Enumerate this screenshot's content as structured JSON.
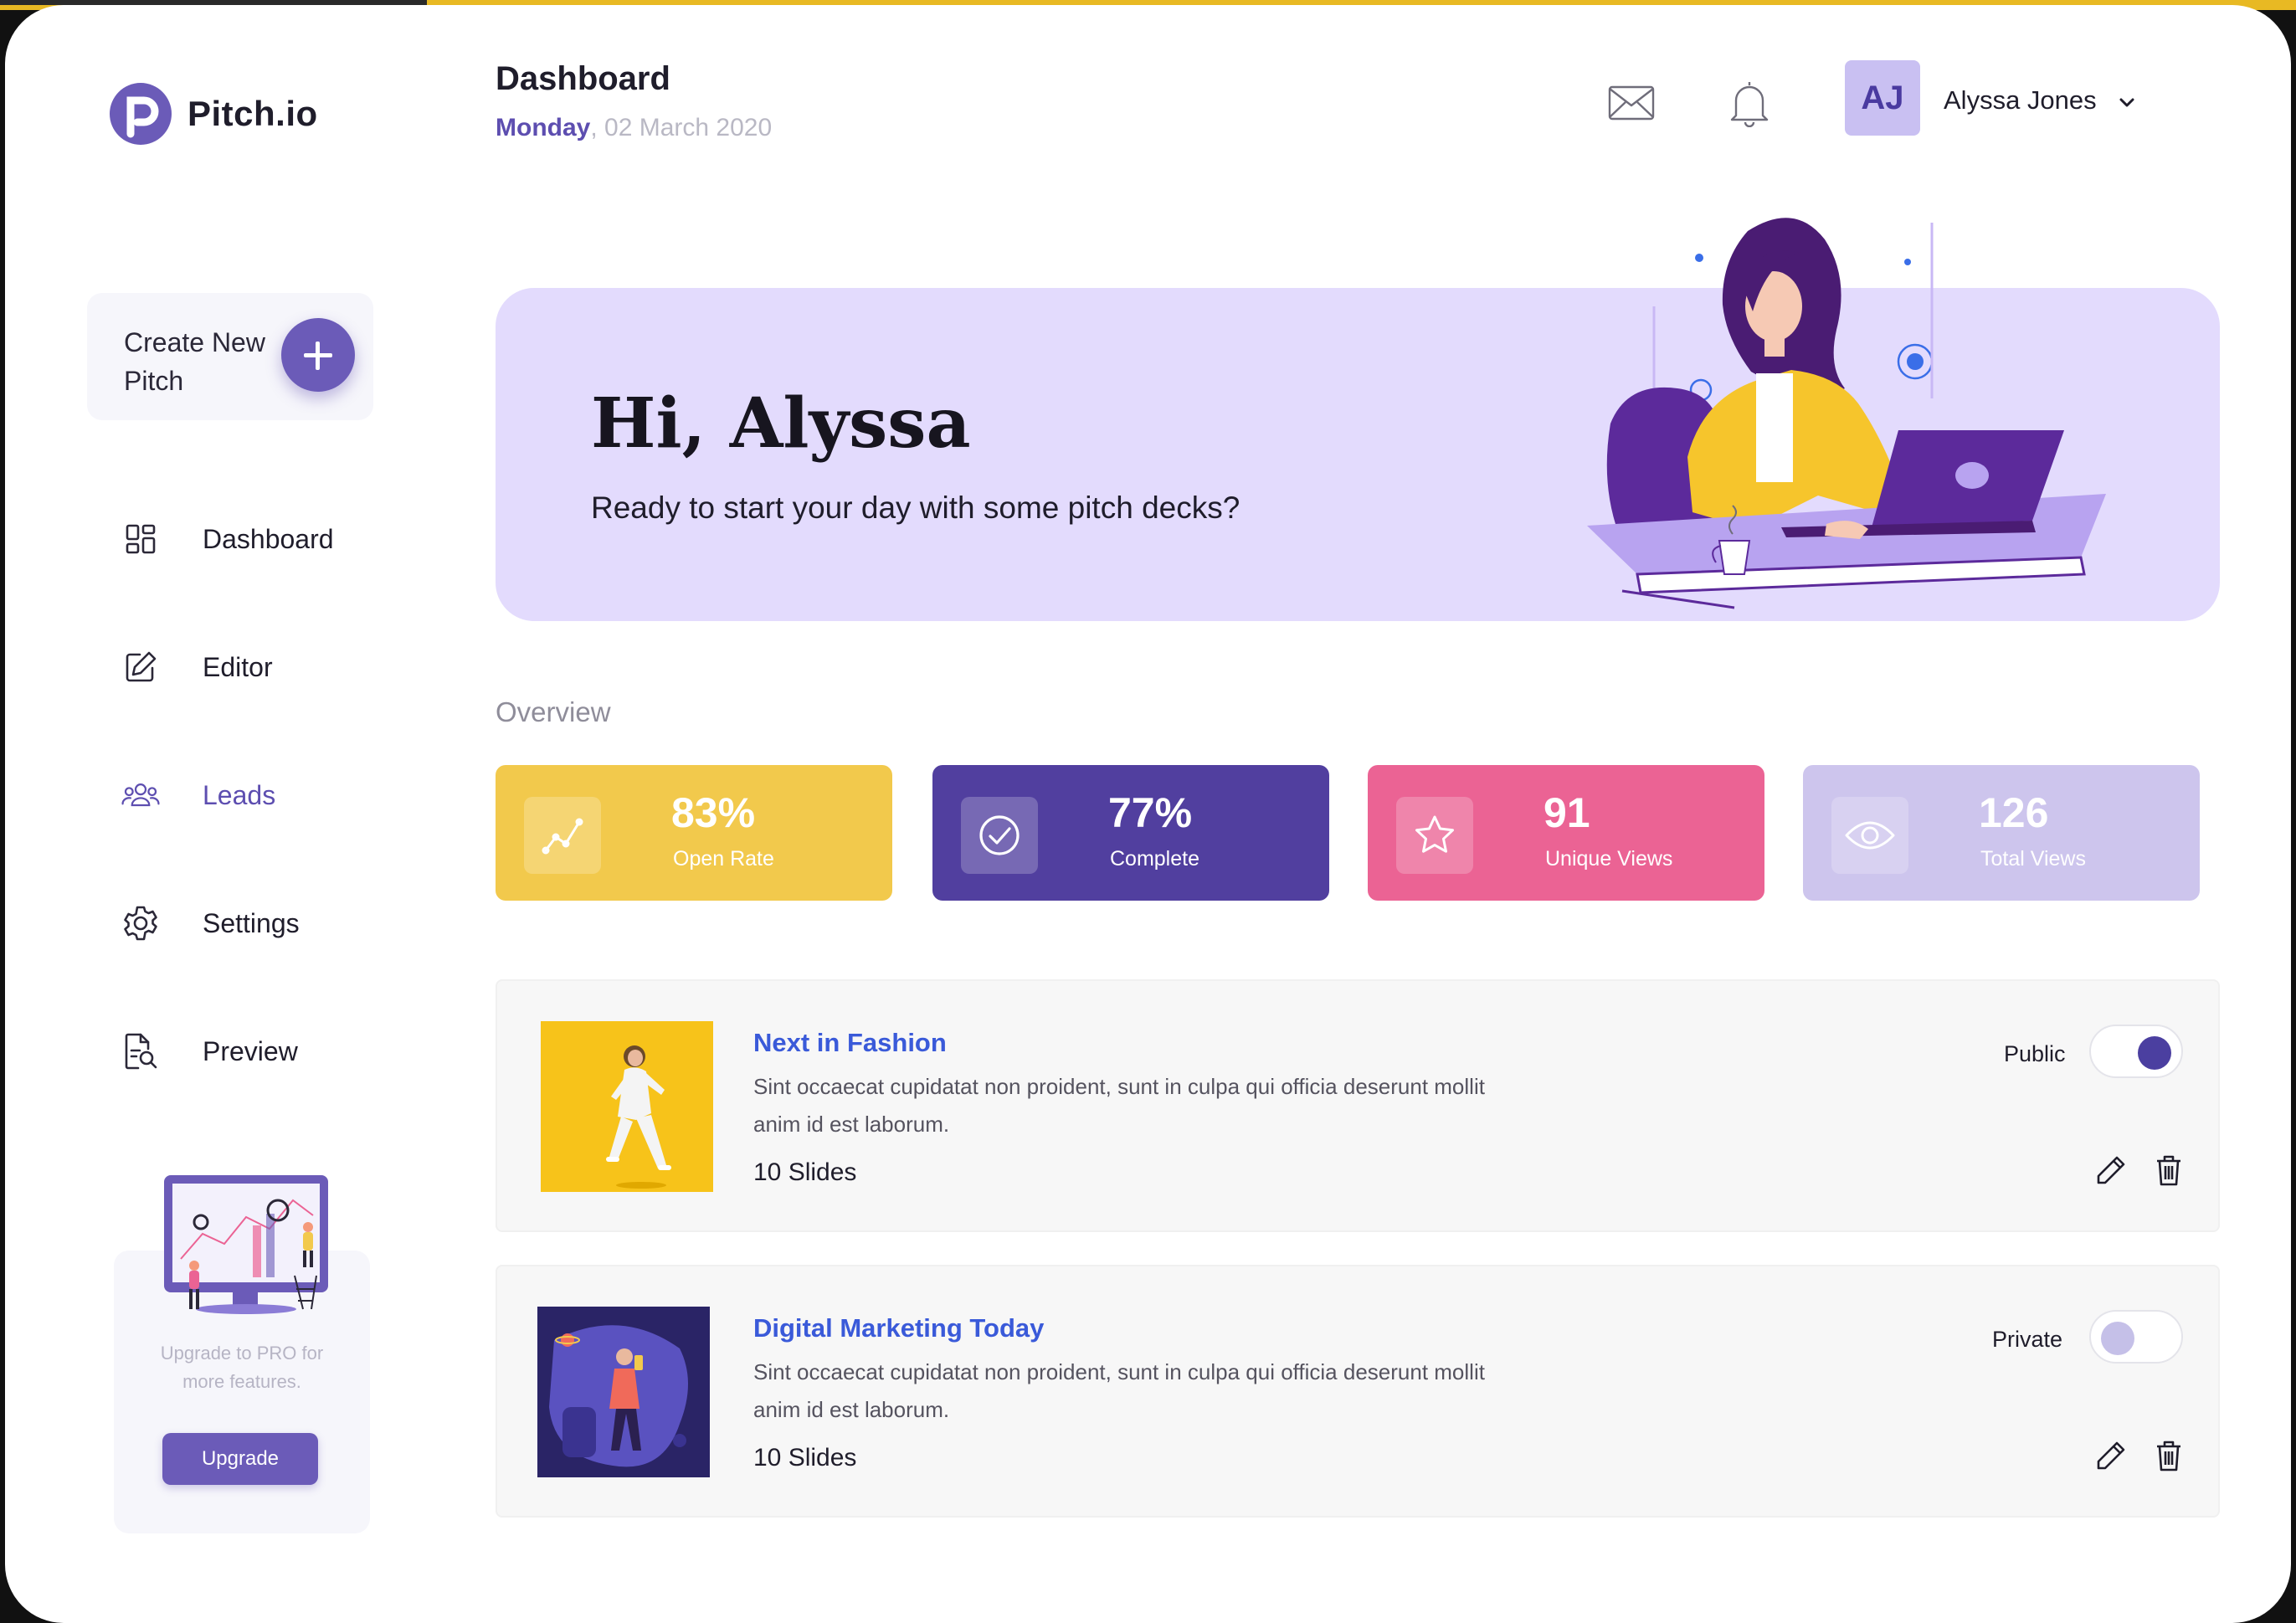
{
  "brand": {
    "name": "Pitch.io",
    "logo_icon": "pitch-logo-icon"
  },
  "sidebar": {
    "create": {
      "label": "Create New Pitch",
      "icon": "plus-icon"
    },
    "items": [
      {
        "label": "Dashboard",
        "icon": "grid-icon",
        "active": false
      },
      {
        "label": "Editor",
        "icon": "edit-icon",
        "active": false
      },
      {
        "label": "Leads",
        "icon": "users-icon",
        "active": true
      },
      {
        "label": "Settings",
        "icon": "gear-icon",
        "active": false
      },
      {
        "label": "Preview",
        "icon": "document-search-icon",
        "active": false
      }
    ],
    "promo": {
      "text": "Upgrade to PRO for more features.",
      "button": "Upgrade"
    }
  },
  "header": {
    "title": "Dashboard",
    "date_day": "Monday",
    "date_rest": ", 02 March 2020",
    "icons": [
      "mail-icon",
      "bell-icon"
    ],
    "user": {
      "initials": "AJ",
      "name": "Alyssa Jones"
    }
  },
  "hero": {
    "greeting": "Hi, Alyssa",
    "subtitle": "Ready to start your day with some pitch decks?"
  },
  "overview": {
    "label": "Overview",
    "stats": [
      {
        "value": "83%",
        "label": "Open Rate",
        "color": "#f2c94c",
        "icon": "trend-icon"
      },
      {
        "value": "77%",
        "label": "Complete",
        "color": "#513f9f",
        "icon": "check-circle-icon"
      },
      {
        "value": "91",
        "label": "Unique Views",
        "color": "#eb6394",
        "icon": "star-icon"
      },
      {
        "value": "126",
        "label": "Total Views",
        "color": "#cdc5ed",
        "icon": "eye-icon"
      }
    ]
  },
  "pitches": [
    {
      "title": "Next in Fashion",
      "description": "Sint occaecat cupidatat non proident, sunt in culpa qui officia deserunt mollit anim id est laborum.",
      "slides": "10 Slides",
      "visibility": "Public",
      "enabled": true
    },
    {
      "title": "Digital Marketing Today",
      "description": "Sint occaecat cupidatat non proident, sunt in culpa qui officia deserunt mollit anim id est laborum.",
      "slides": "10 Slides",
      "visibility": "Private",
      "enabled": false
    }
  ],
  "colors": {
    "accent": "#6b5bb8",
    "hero_bg": "#e3dbfd",
    "link": "#3a5ad9"
  }
}
